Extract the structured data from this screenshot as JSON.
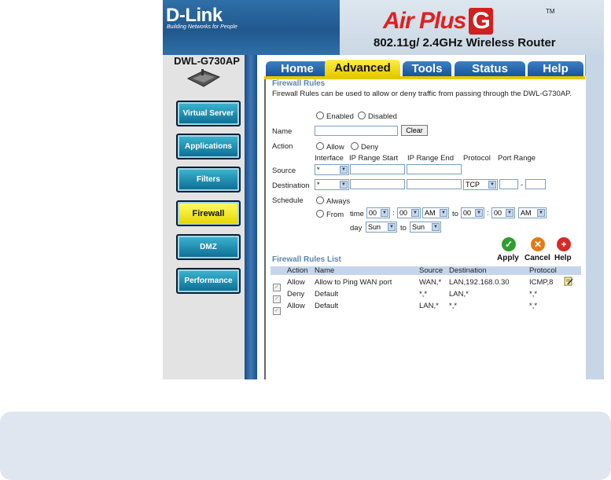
{
  "header": {
    "logo": "D-Link",
    "tagline": "Building Networks for People",
    "brand": "Air Plus",
    "brand_g": "G",
    "tm": "TM",
    "subtitle": "802.11g/ 2.4GHz Wireless Router"
  },
  "sidebar": {
    "model": "DWL-G730AP",
    "items": [
      {
        "label": "Virtual Server",
        "active": false
      },
      {
        "label": "Applications",
        "active": false
      },
      {
        "label": "Filters",
        "active": false
      },
      {
        "label": "Firewall",
        "active": true
      },
      {
        "label": "DMZ",
        "active": false
      },
      {
        "label": "Performance",
        "active": false
      }
    ]
  },
  "tabs": [
    {
      "label": "Home",
      "active": false
    },
    {
      "label": "Advanced",
      "active": true
    },
    {
      "label": "Tools",
      "active": false
    },
    {
      "label": "Status",
      "active": false
    },
    {
      "label": "Help",
      "active": false
    }
  ],
  "firewall": {
    "section_title": "Firewall Rules",
    "description": "Firewall Rules can be used to allow or deny traffic from passing through the DWL-G730AP.",
    "enabled_label": "Enabled",
    "disabled_label": "Disabled",
    "name_label": "Name",
    "name_value": "",
    "clear_label": "Clear",
    "action_label": "Action",
    "allow_label": "Allow",
    "deny_label": "Deny",
    "col_interface": "Interface",
    "col_ip_start": "IP Range Start",
    "col_ip_end": "IP Range End",
    "col_protocol": "Protocol",
    "col_port_range": "Port Range",
    "source_label": "Source",
    "source_interface": "*",
    "destination_label": "Destination",
    "destination_interface": "*",
    "destination_protocol": "TCP",
    "port_dash": "-",
    "schedule_label": "Schedule",
    "always_label": "Always",
    "from_label": "From",
    "time_label": "time",
    "from_hour": "00",
    "from_minute": "00",
    "from_ampm": "AM",
    "to_label": "to",
    "to_hour": "00",
    "to_minute": "00",
    "to_ampm": "AM",
    "colon": ":",
    "day_label": "day",
    "day_from": "Sun",
    "day_to": "Sun"
  },
  "actions": {
    "apply": "Apply",
    "cancel": "Cancel",
    "help": "Help"
  },
  "rules_list": {
    "title": "Firewall Rules List",
    "headers": [
      "Action",
      "Name",
      "Source",
      "Destination",
      "Protocol"
    ],
    "rows": [
      {
        "action": "Allow",
        "name": "Allow to Ping WAN port",
        "source": "WAN,*",
        "destination": "LAN,192.168.0.30",
        "protocol": "ICMP,8",
        "editable": true
      },
      {
        "action": "Deny",
        "name": "Default",
        "source": "*,*",
        "destination": "LAN,*",
        "protocol": "*,*",
        "editable": false
      },
      {
        "action": "Allow",
        "name": "Default",
        "source": "LAN,*",
        "destination": "*,*",
        "protocol": "*,*",
        "editable": false
      }
    ]
  },
  "colors": {
    "accent_blue": "#17559b",
    "active_yellow": "#e5cc00",
    "section_title": "#5d85b0",
    "apply_green": "#2f9d2f",
    "cancel_orange": "#e07b16",
    "help_red": "#d42a2a"
  }
}
